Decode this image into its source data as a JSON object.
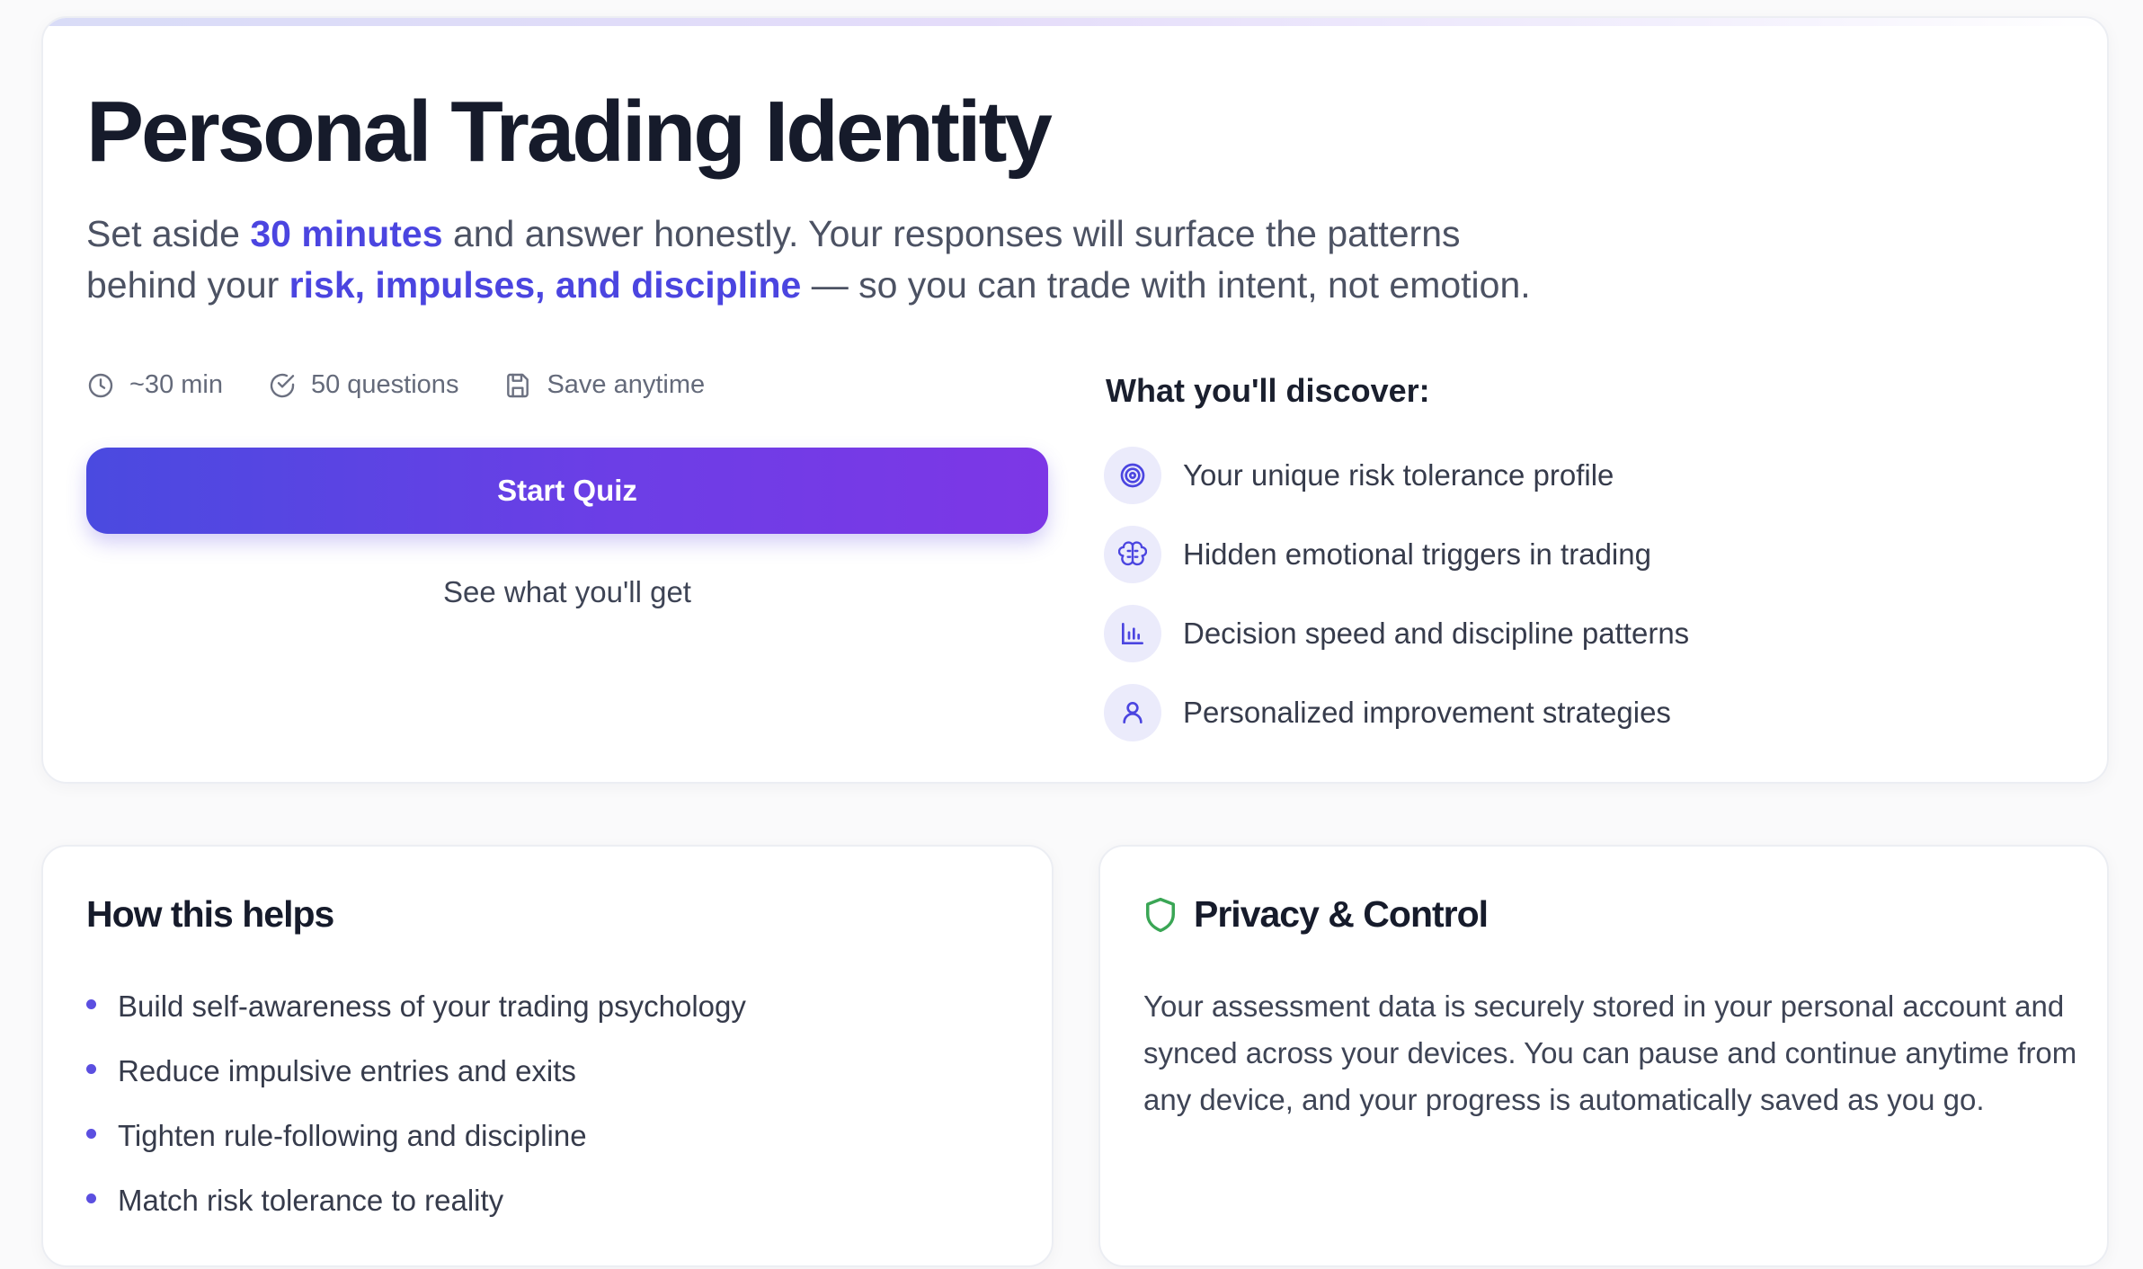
{
  "hero": {
    "title": "Personal Trading Identity",
    "intro": {
      "p1": "Set aside ",
      "h1": "30 minutes",
      "p2": " and answer honestly. Your responses will surface the patterns behind your ",
      "h2": "risk, impulses, and discipline",
      "p3": " — so you can trade with intent, not emotion."
    },
    "meta": [
      {
        "icon": "clock-icon",
        "label": "~30 min"
      },
      {
        "icon": "check-circle-icon",
        "label": "50 questions"
      },
      {
        "icon": "save-icon",
        "label": "Save anytime"
      }
    ],
    "start_button": "Start Quiz",
    "see_link": "See what you'll get",
    "discover": {
      "title": "What you'll discover:",
      "items": [
        {
          "icon": "target-icon",
          "label": "Your unique risk tolerance profile"
        },
        {
          "icon": "brain-icon",
          "label": "Hidden emotional triggers in trading"
        },
        {
          "icon": "bar-chart-icon",
          "label": "Decision speed and discipline patterns"
        },
        {
          "icon": "user-icon",
          "label": "Personalized improvement strategies"
        }
      ]
    }
  },
  "helps": {
    "title": "How this helps",
    "items": [
      "Build self-awareness of your trading psychology",
      "Reduce impulsive entries and exits",
      "Tighten rule-following and discipline",
      "Match risk tolerance to reality"
    ]
  },
  "privacy": {
    "icon": "shield-icon",
    "title": "Privacy & Control",
    "text": "Your assessment data is securely stored in your personal account and synced across your devices. You can pause and continue anytime from any device, and your progress is automatically saved as you go."
  },
  "colors": {
    "accent": "#4b45e0",
    "button_gradient_start": "#4a4ae0",
    "button_gradient_end": "#7d37e6",
    "shield": "#3aa655"
  }
}
